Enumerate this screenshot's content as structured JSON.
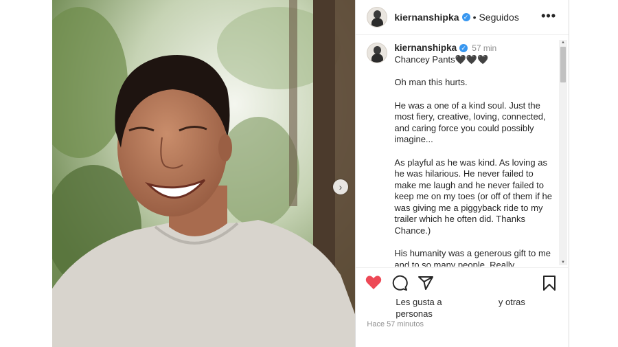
{
  "post": {
    "username": "kiernanshipka",
    "follow_status": "Seguidos",
    "more_label": "•••",
    "verified_mark": "✓",
    "separator": "•"
  },
  "caption": {
    "username": "kiernanshipka",
    "time": "57 min",
    "paragraphs": [
      "Chancey Pants🖤🖤🖤",
      "Oh man this hurts.",
      "He was a one of a kind soul. Just the most fiery, creative, loving, connected, and caring force you could possibly imagine...",
      "As playful as he was kind. As loving as he was hilarious. He never failed to make me laugh and he never failed to keep me on my toes (or off of them if he was giving me a piggyback ride to my trailer which he often did. Thanks Chance.)",
      "His humanity was a generous gift to me and to so many people. Really"
    ]
  },
  "likes": {
    "prefix": "Les gusta a",
    "suffix": "y otras",
    "line2": "personas"
  },
  "timestamp": "Hace 57 minutos",
  "icons": {
    "like": "heart-icon",
    "comment": "comment-icon",
    "share": "share-icon",
    "save": "bookmark-icon",
    "next": "chevron-right-icon"
  },
  "colors": {
    "like_red": "#ed4956",
    "verified_blue": "#3897f0"
  }
}
